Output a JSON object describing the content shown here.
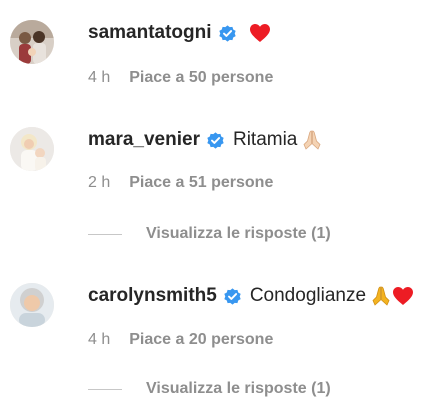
{
  "comments": [
    {
      "username": "samantatogni",
      "text": "",
      "emoji": "red-heart-icon",
      "time": "4 h",
      "likes": "Piace a 50 persone"
    },
    {
      "username": "mara_venier",
      "text": "Ritamia",
      "emoji": "folded-hands-icon",
      "time": "2 h",
      "likes": "Piace a 51 persone",
      "replies": "Visualizza le risposte (1)"
    },
    {
      "username": "carolynsmith5",
      "text": "Condoglianze",
      "emoji": "folded-hands-and-heart-icon",
      "time": "4 h",
      "likes": "Piace a 20 persone",
      "replies": "Visualizza le risposte (1)"
    }
  ],
  "colors": {
    "verified_blue": "#3897f0",
    "meta_gray": "#8e8e8e",
    "heart_red": "#ed1c24"
  }
}
